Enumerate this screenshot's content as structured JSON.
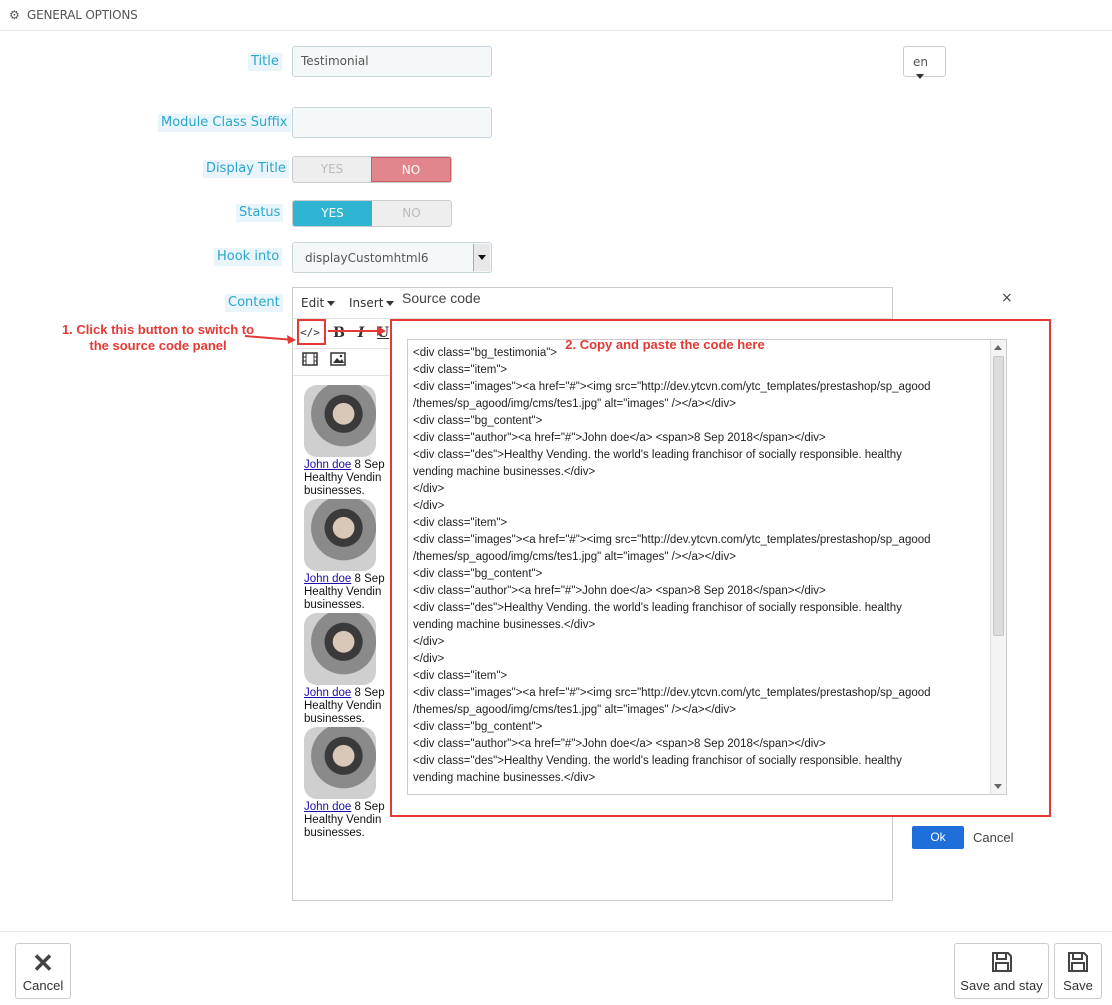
{
  "panel": {
    "title": "GENERAL OPTIONS",
    "icon": "gears-icon"
  },
  "form": {
    "title_label": "Title",
    "title_value": "Testimonial",
    "lang_value": "en",
    "suffix_label": "Module Class Suffix",
    "suffix_value": "",
    "display_title_label": "Display Title",
    "display_title_yes": "YES",
    "display_title_no": "NO",
    "display_title_selected": "NO",
    "status_label": "Status",
    "status_yes": "YES",
    "status_no": "NO",
    "status_selected": "YES",
    "hook_label": "Hook into",
    "hook_value": "displayCustomhtml6",
    "content_label": "Content"
  },
  "editor": {
    "menu_edit": "Edit",
    "menu_insert": "Insert",
    "tool_source": "</>",
    "tool_bold": "B",
    "tool_italic": "I",
    "tool_underline": "U",
    "cards": [
      {
        "author": "John doe",
        "date": "8 Sep",
        "line1": "Healthy Vendin",
        "line2": "businesses."
      },
      {
        "author": "John doe",
        "date": "8 Sep",
        "line1": "Healthy Vendin",
        "line2": "businesses."
      },
      {
        "author": "John doe",
        "date": "8 Sep",
        "line1": "Healthy Vendin",
        "line2": "businesses."
      },
      {
        "author": "John doe",
        "date": "8 Sep",
        "line1": "Healthy Vendin",
        "line2": "businesses."
      }
    ]
  },
  "modal": {
    "title": "Source code",
    "close": "×",
    "ok_label": "Ok",
    "cancel_label": "Cancel",
    "code_lines": [
      "<div class=\"bg_testimonia\">",
      "<div class=\"item\">",
      "<div class=\"images\"><a href=\"#\"><img src=\"http://dev.ytcvn.com/ytc_templates/prestashop/sp_agood",
      "/themes/sp_agood/img/cms/tes1.jpg\" alt=\"images\" /></a></div>",
      "<div class=\"bg_content\">",
      "<div class=\"author\"><a href=\"#\">John doe</a> <span>8 Sep 2018</span></div>",
      "<div class=\"des\">Healthy Vending. the world's leading franchisor of socially responsible. healthy",
      "vending machine businesses.</div>",
      "</div>",
      "</div>",
      "<div class=\"item\">",
      "<div class=\"images\"><a href=\"#\"><img src=\"http://dev.ytcvn.com/ytc_templates/prestashop/sp_agood",
      "/themes/sp_agood/img/cms/tes1.jpg\" alt=\"images\" /></a></div>",
      "<div class=\"bg_content\">",
      "<div class=\"author\"><a href=\"#\">John doe</a> <span>8 Sep 2018</span></div>",
      "<div class=\"des\">Healthy Vending. the world's leading franchisor of socially responsible. healthy",
      "vending machine businesses.</div>",
      "</div>",
      "</div>",
      "<div class=\"item\">",
      "<div class=\"images\"><a href=\"#\"><img src=\"http://dev.ytcvn.com/ytc_templates/prestashop/sp_agood",
      "/themes/sp_agood/img/cms/tes1.jpg\" alt=\"images\" /></a></div>",
      "<div class=\"bg_content\">",
      "<div class=\"author\"><a href=\"#\">John doe</a> <span>8 Sep 2018</span></div>",
      "<div class=\"des\">Healthy Vending. the world's leading franchisor of socially responsible. healthy",
      "vending machine businesses.</div>"
    ]
  },
  "annotations": {
    "step1": "1. Click this button to switch to the source code panel",
    "step2": "2. Copy and paste the code here",
    "color": "#e53935"
  },
  "footer": {
    "cancel_label": "Cancel",
    "save_stay_label": "Save and stay",
    "save_label": "Save"
  },
  "colors": {
    "accent": "#2fb5d2",
    "danger": "#e0868c",
    "primary": "#1e6fd9",
    "label": "#2ba6cb"
  }
}
